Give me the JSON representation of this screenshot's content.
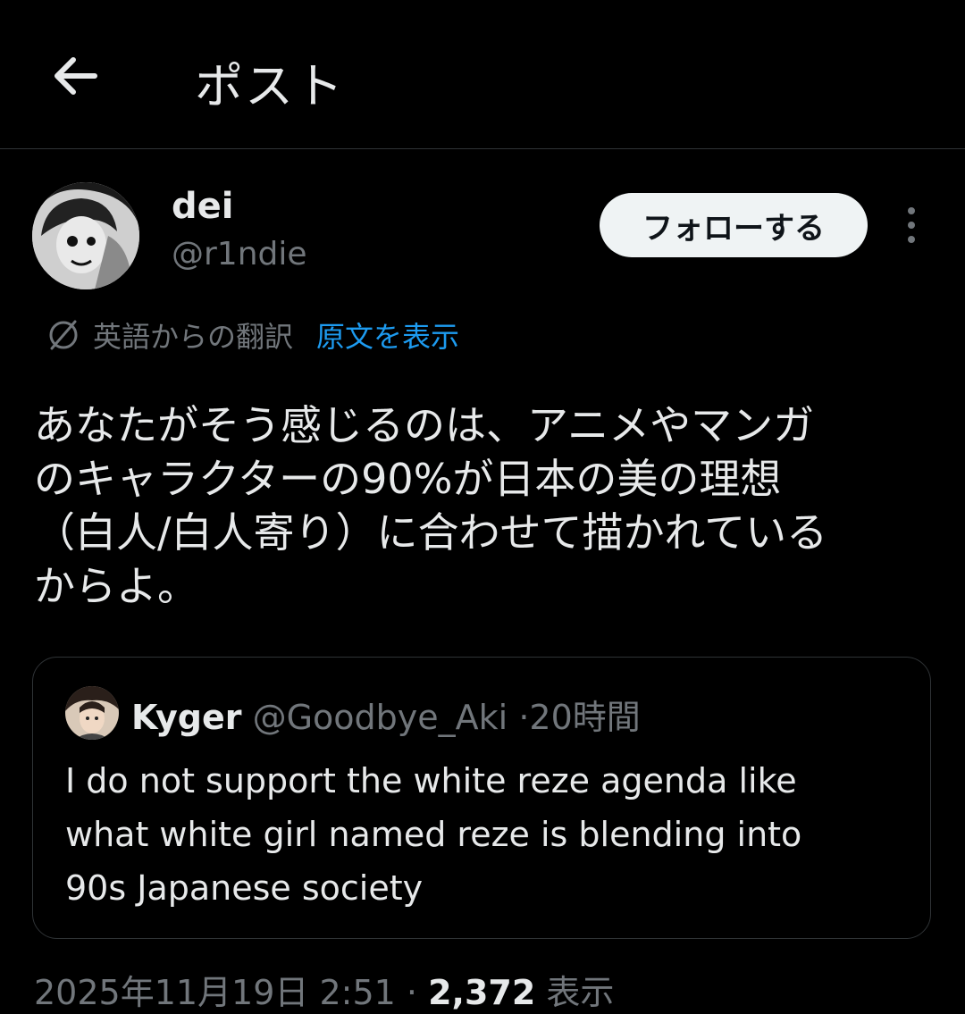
{
  "header": {
    "back_icon": "arrow-left-icon",
    "title": "ポスト"
  },
  "author": {
    "display_name": "dei",
    "handle": "@r1ndie",
    "follow_label": "フォローする",
    "more_icon": "vertical-dots-icon"
  },
  "translation": {
    "icon": "translate-globe-icon",
    "label": "英語からの翻訳",
    "show_original": "原文を表示"
  },
  "post": {
    "lines": [
      "あなたがそう感じるのは、アニメやマンガ",
      "のキャラクターの90%が日本の美の理想",
      "（白人/白人寄り）に合わせて描かれている",
      "からよ。"
    ]
  },
  "quote": {
    "name": "Kyger",
    "handle": "@Goodbye_Aki",
    "separator": "·",
    "time": "20時間",
    "lines": [
      "I do not support the white reze agenda like",
      "what white girl named reze is blending into",
      "90s Japanese society"
    ]
  },
  "meta": {
    "timestamp": "2025年11月19日 2:51",
    "separator": "·",
    "views_count": "2,372",
    "views_label": "表示"
  },
  "colors": {
    "background": "#000000",
    "text": "#e7e9ea",
    "secondary": "#71767b",
    "link": "#1d9bf0",
    "border": "#2f3336"
  }
}
